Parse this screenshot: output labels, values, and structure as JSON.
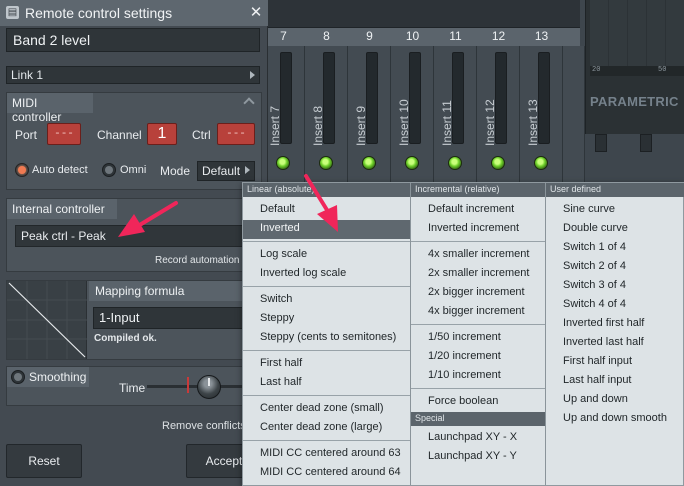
{
  "dialog": {
    "title": "Remote control settings",
    "band_value": "Band 2 level",
    "link_value": "Link 1",
    "midi": {
      "header": "MIDI controller",
      "port_label": "Port",
      "port_value": "---",
      "channel_label": "Channel",
      "channel_value": "1",
      "ctrl_label": "Ctrl",
      "ctrl_value": "---",
      "auto_detect_label": "Auto detect",
      "omni_label": "Omni",
      "mode_label": "Mode",
      "mode_value": "Default"
    },
    "internal": {
      "header": "Internal controller",
      "value": "Peak ctrl - Peak",
      "record_label": "Record automation"
    },
    "mapping": {
      "header": "Mapping formula",
      "formula": "1-Input",
      "status": "Compiled ok."
    },
    "smoothing": {
      "header": "Smoothing",
      "time_label": "Time"
    },
    "remove_conflicts": "Remove conflicts",
    "reset_label": "Reset",
    "accept_label": "Accept"
  },
  "mixer": {
    "numbers": [
      "7",
      "8",
      "9",
      "10",
      "11",
      "12",
      "13"
    ],
    "inserts": [
      "Insert 7",
      "Insert 8",
      "Insert 9",
      "Insert 10",
      "Insert 11",
      "Insert 12",
      "Insert 13"
    ],
    "parametric_title": "PARAMETRIC",
    "scale": [
      "20",
      "50"
    ]
  },
  "menu": {
    "col_a": {
      "header": "Linear (absolute)",
      "groups": [
        [
          "Default",
          "Inverted"
        ],
        [
          "Log scale",
          "Inverted log scale"
        ],
        [
          "Switch",
          "Steppy",
          "Steppy (cents to semitones)"
        ],
        [
          "First half",
          "Last half"
        ],
        [
          "Center dead zone (small)",
          "Center dead zone (large)"
        ],
        [
          "MIDI CC centered around 63",
          "MIDI CC centered around 64"
        ]
      ],
      "selected": "Inverted"
    },
    "col_b": {
      "header": "Incremental (relative)",
      "groups": [
        [
          "Default increment",
          "Inverted increment"
        ],
        [
          "4x smaller increment",
          "2x smaller increment",
          "2x bigger increment",
          "4x bigger increment"
        ],
        [
          "1/50 increment",
          "1/20 increment",
          "1/10 increment"
        ],
        [
          "Force boolean"
        ]
      ],
      "special_header": "Special",
      "special": [
        "Launchpad XY - X",
        "Launchpad XY - Y"
      ]
    },
    "col_c": {
      "header": "User defined",
      "items": [
        "Sine curve",
        "Double curve",
        "Switch 1 of 4",
        "Switch 2 of 4",
        "Switch 3 of 4",
        "Switch 4 of 4",
        "Inverted first half",
        "Inverted last half",
        "First half input",
        "Last half input",
        "Up and down",
        "Up and down smooth"
      ]
    }
  },
  "colors": {
    "accent_red": "#b8413b",
    "annotation_pink": "#f0265a",
    "led_green": "#6fd12a",
    "menu_bg": "#dde3e6",
    "menu_selected": "#5f686f"
  }
}
